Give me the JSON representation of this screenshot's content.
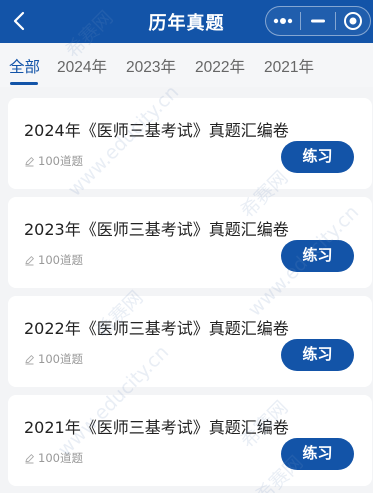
{
  "header": {
    "title": "历年真题"
  },
  "tabs": [
    "全部",
    "2024年",
    "2023年",
    "2022年",
    "2021年"
  ],
  "active_tab": "全部",
  "cards": [
    {
      "title": "2024年《医师三基考试》真题汇编卷",
      "count": "100道题",
      "button": "练习"
    },
    {
      "title": "2023年《医师三基考试》真题汇编卷",
      "count": "100道题",
      "button": "练习"
    },
    {
      "title": "2022年《医师三基考试》真题汇编卷",
      "count": "100道题",
      "button": "练习"
    },
    {
      "title": "2021年《医师三基考试》真题汇编卷",
      "count": "100道题",
      "button": "练习"
    }
  ],
  "watermark": {
    "text_cn": "希赛网",
    "text_url": "www.educity.cn"
  },
  "colors": {
    "brand": "#1354a8",
    "page_bg": "#f3f4f6"
  }
}
